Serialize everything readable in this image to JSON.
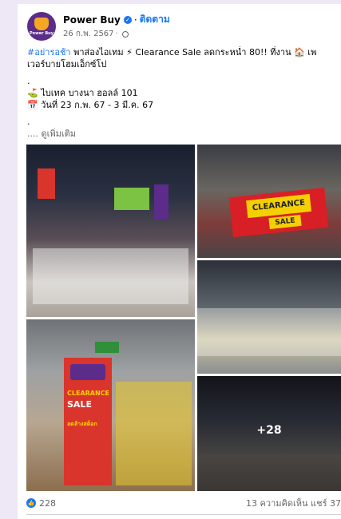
{
  "post": {
    "page_name": "Power Buy",
    "avatar_text": "Power Buy",
    "follow_label": "ติดตาม",
    "date": "26 ก.พ. 2567",
    "hashtag": "#อย่ารอช้า",
    "line1_rest": " พาส่องไอเทม ⚡ Clearance Sale ลดกระหน่ำ 80!! ที่งาน 🏠 เพ",
    "line2": "เวอร์บายโฮมเอ็กซ์โป",
    "dot1": ".",
    "location": "⛳ ไบเทค บางนา ฮอลล์ 101",
    "dates": "📅 วันที่ 23 ก.พ. 67 - 3 มี.ค. 67",
    "dot2": ".",
    "see_more": ".... ดูเพิ่มเติม"
  },
  "photos": {
    "more_count": "+28",
    "clearance_banner": "CLEARANCE",
    "sale_banner": "SALE",
    "sign_clearance": "CLEARANCE",
    "sign_sale": "SALE",
    "sign_sub": "ลดล้างสต็อก"
  },
  "stats": {
    "likes": "228",
    "comments_shares": "13 ความคิดเห็น แชร์ 37"
  },
  "colors": {
    "brand_purple": "#5b2c8a",
    "link_blue": "#1877f2",
    "clearance_red": "#d81f26"
  }
}
